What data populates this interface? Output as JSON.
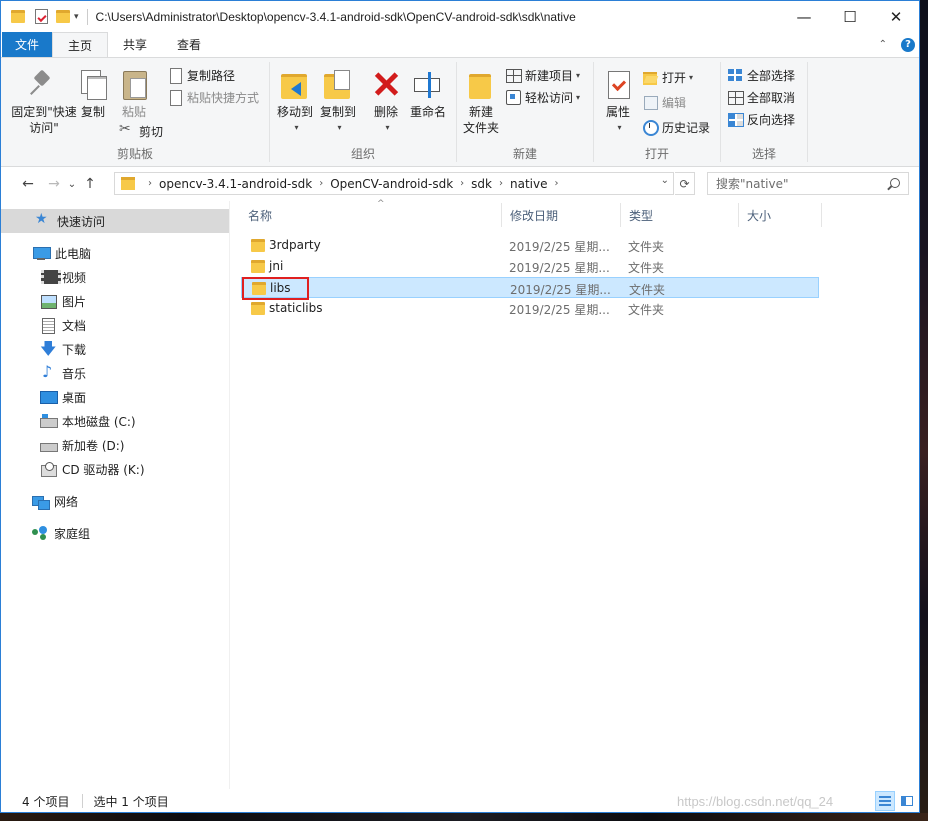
{
  "titlebar": {
    "path": "C:\\Users\\Administrator\\Desktop\\opencv-3.4.1-android-sdk\\OpenCV-android-sdk\\sdk\\native",
    "minimize": "—",
    "maximize": "☐",
    "close": "✕"
  },
  "tabs": {
    "file": "文件",
    "home": "主页",
    "share": "共享",
    "view": "查看",
    "expand_chevron": "⌃",
    "help": "?"
  },
  "ribbon": {
    "clipboard": {
      "label": "剪贴板",
      "pin_quick_access": "固定到\"快速访问\"",
      "copy": "复制",
      "paste": "粘贴",
      "copy_path": "复制路径",
      "paste_shortcut": "粘贴快捷方式",
      "cut": "剪切"
    },
    "organize": {
      "label": "组织",
      "move_to": "移动到",
      "copy_to": "复制到",
      "delete": "删除",
      "rename": "重命名"
    },
    "new": {
      "label": "新建",
      "new_folder": "新建\n文件夹",
      "new_item": "新建项目",
      "easy_access": "轻松访问"
    },
    "open": {
      "label": "打开",
      "properties": "属性",
      "open": "打开",
      "edit": "编辑",
      "history": "历史记录"
    },
    "select": {
      "label": "选择",
      "select_all": "全部选择",
      "select_none": "全部取消",
      "invert_selection": "反向选择"
    }
  },
  "address": {
    "back": "←",
    "forward": "→",
    "recent": "⌄",
    "up": "↑",
    "crumbs": [
      "opencv-3.4.1-android-sdk",
      "OpenCV-android-sdk",
      "sdk",
      "native"
    ],
    "crumb_sep": "›",
    "dropdown": "⌄",
    "refresh": "⟳",
    "search_placeholder": "搜索\"native\""
  },
  "nav": {
    "items": [
      {
        "label": "快速访问",
        "icon": "star-icon"
      },
      {
        "label": "此电脑",
        "icon": "computer-icon"
      },
      {
        "label": "视频",
        "icon": "video-icon"
      },
      {
        "label": "图片",
        "icon": "pictures-icon"
      },
      {
        "label": "文档",
        "icon": "documents-icon"
      },
      {
        "label": "下载",
        "icon": "download-icon"
      },
      {
        "label": "音乐",
        "icon": "music-icon"
      },
      {
        "label": "桌面",
        "icon": "desktop-icon"
      },
      {
        "label": "本地磁盘 (C:)",
        "icon": "disk-icon"
      },
      {
        "label": "新加卷 (D:)",
        "icon": "volume-icon"
      },
      {
        "label": "CD 驱动器 (K:)",
        "icon": "cd-drive-icon"
      },
      {
        "label": "网络",
        "icon": "network-icon"
      },
      {
        "label": "家庭组",
        "icon": "homegroup-icon"
      }
    ]
  },
  "filelist": {
    "columns": {
      "name": "名称",
      "date": "修改日期",
      "type": "类型",
      "size": "大小"
    },
    "sort_arrow": "^",
    "rows": [
      {
        "name": "3rdparty",
        "date": "2019/2/25 星期...",
        "type": "文件夹",
        "selected": false
      },
      {
        "name": "jni",
        "date": "2019/2/25 星期...",
        "type": "文件夹",
        "selected": false
      },
      {
        "name": "libs",
        "date": "2019/2/25 星期...",
        "type": "文件夹",
        "selected": true
      },
      {
        "name": "staticlibs",
        "date": "2019/2/25 星期...",
        "type": "文件夹",
        "selected": false
      }
    ]
  },
  "status": {
    "count": "4 个项目",
    "selected": "选中 1 个项目",
    "watermark": "https://blog.csdn.net/qq_24"
  },
  "colors": {
    "accent": "#1979ca",
    "selection": "#cce8ff",
    "highlight_box": "#e02020",
    "folder": "#f7c948"
  }
}
